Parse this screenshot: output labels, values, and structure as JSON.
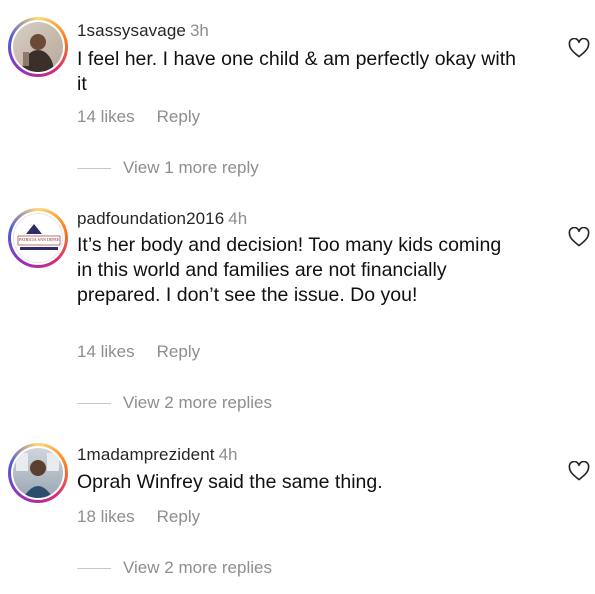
{
  "comments": [
    {
      "username": "1sassysavage",
      "time": "3h",
      "text": "I feel her. I have one child & am perfectly okay with it",
      "likes": "14 likes",
      "reply": "Reply",
      "view_more": "View 1 more reply"
    },
    {
      "username": "padfoundation2016",
      "time": "4h",
      "text": "It’s her body and decision! Too many kids coming in this world and families are not financially prepared. I don’t see the issue. Do you!",
      "likes": "14 likes",
      "reply": "Reply",
      "view_more": "View 2 more replies",
      "avatar_text": "PATRICIA ANN DEPEE"
    },
    {
      "username": "1madamprezident",
      "time": "4h",
      "text": "Oprah Winfrey said the same thing.",
      "likes": "18 likes",
      "reply": "Reply",
      "view_more": "View 2 more replies"
    }
  ],
  "icons": {
    "like": "heart-outline-icon"
  },
  "colors": {
    "text": "#262626",
    "muted": "#8e8e8e",
    "divider": "#c7c7c7"
  }
}
